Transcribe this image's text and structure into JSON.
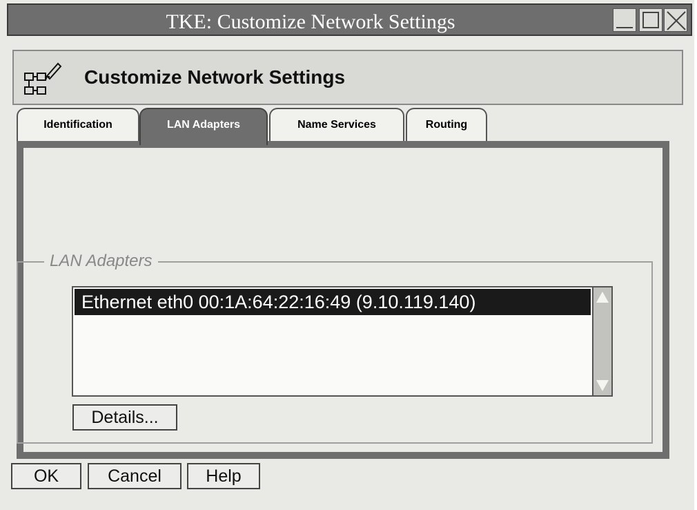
{
  "window": {
    "title": "TKE: Customize Network Settings"
  },
  "banner": {
    "title": "Customize Network Settings",
    "icon": "network-edit-icon"
  },
  "tabs": [
    {
      "label": "Identification",
      "active": false
    },
    {
      "label": "LAN Adapters",
      "active": true
    },
    {
      "label": "Name Services",
      "active": false
    },
    {
      "label": "Routing",
      "active": false
    }
  ],
  "lan_adapters": {
    "group_label": "LAN Adapters",
    "items": [
      "Ethernet eth0 00:1A:64:22:16:49 (9.10.119.140)"
    ],
    "selected_index": 0,
    "details_label": "Details..."
  },
  "footer": {
    "ok_label": "OK",
    "cancel_label": "Cancel",
    "help_label": "Help"
  },
  "colors": {
    "titlebar": "#6e6e6e",
    "selection": "#1a1a1a",
    "background": "#e9e9e6"
  }
}
